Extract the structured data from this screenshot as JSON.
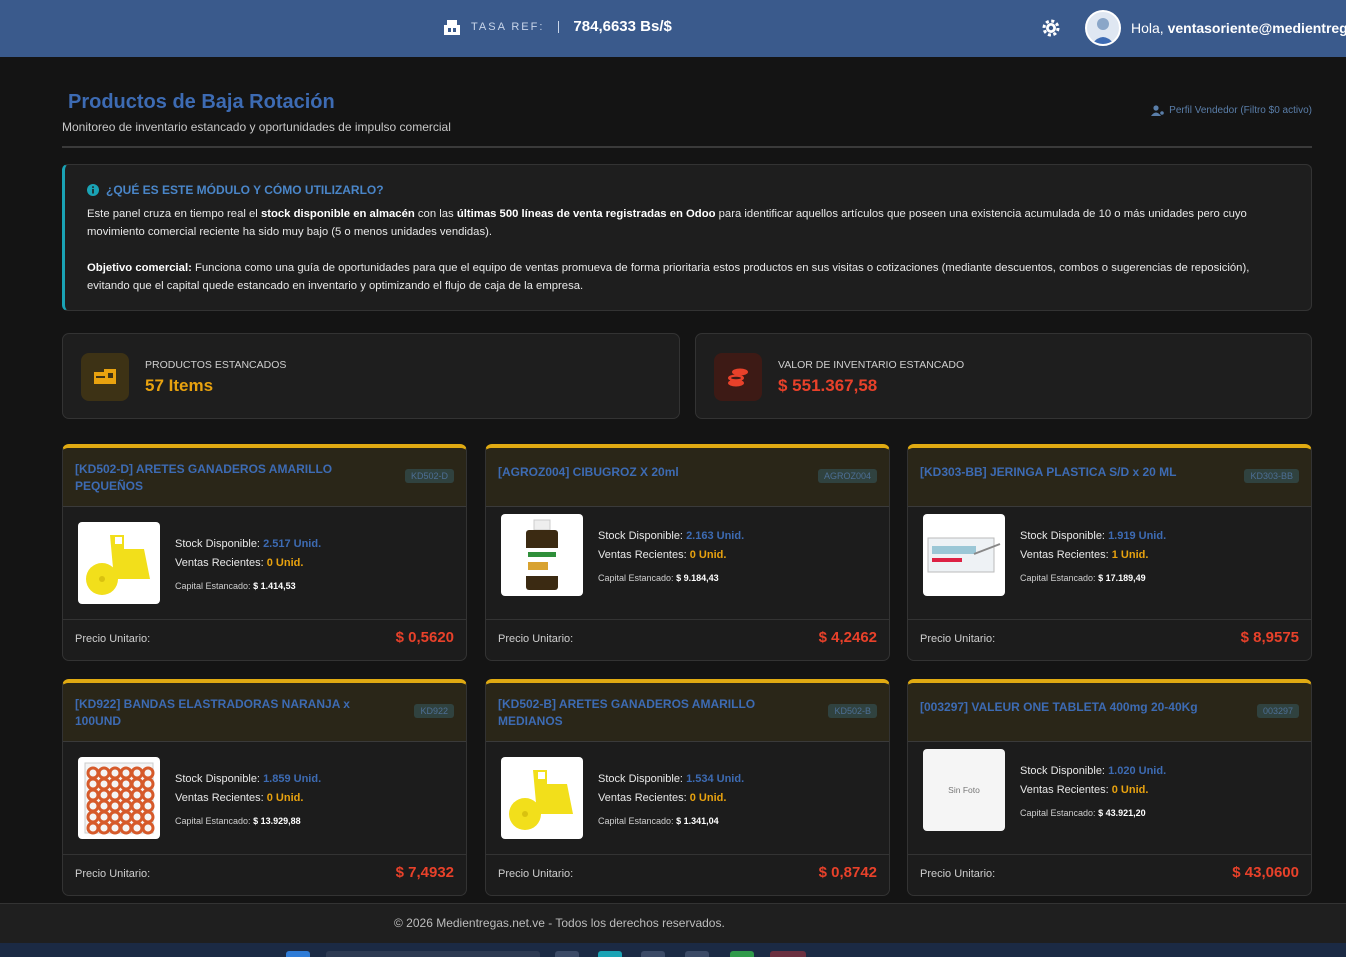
{
  "topbar": {
    "rate_label": "TASA REF:",
    "rate_value": "784,6633 Bs/$",
    "greeting_prefix": "Hola,",
    "user": "ventasoriente@medientregas.net.ve"
  },
  "page": {
    "title": "Productos de Baja Rotación",
    "subtitle": "Monitoreo de inventario estancado y oportunidades de impulso comercial",
    "profile_note": "Perfil Vendedor (Filtro $0 activo)"
  },
  "info": {
    "heading": "¿QUÉ ES ESTE MÓDULO Y CÓMO UTILIZARLO?",
    "p1_a": "Este panel cruza en tiempo real el ",
    "p1_b": "stock disponible en almacén",
    "p1_c": " con las ",
    "p1_d": "últimas 500 líneas de venta registradas en Odoo",
    "p1_e": " para identificar aquellos artículos que poseen una existencia acumulada de 10 o más unidades pero cuyo movimiento comercial reciente ha sido muy bajo (5 o menos unidades vendidas).",
    "p2_a": "Objetivo comercial:",
    "p2_b": " Funciona como una guía de oportunidades para que el equipo de ventas promueva de forma prioritaria estos productos en sus visitas o cotizaciones (mediante descuentos, combos o sugerencias de reposición), evitando que el capital quede estancado en inventario y optimizando el flujo de caja de la empresa."
  },
  "stats": {
    "products_label": "PRODUCTOS ESTANCADOS",
    "products_value": "57 Items",
    "value_label": "VALOR DE INVENTARIO ESTANCADO",
    "value_value": "$ 551.367,58"
  },
  "labels": {
    "stock": "Stock Disponible:",
    "sales": "Ventas Recientes:",
    "capital": "Capital Estancado:",
    "price": "Precio Unitario:",
    "no_photo": "Sin Foto"
  },
  "products": [
    {
      "title": "[KD502-D] ARETES GANADEROS AMARILLO PEQUEÑOS",
      "code": "KD502-D",
      "stock": "2.517 Unid.",
      "sales": "0 Unid.",
      "capital": "$ 1.414,53",
      "price": "$ 0,5620",
      "image": "yellow-ear-tag"
    },
    {
      "title": "[AGROZ004] CIBUGROZ X 20ml",
      "code": "AGROZ004",
      "stock": "2.163 Unid.",
      "sales": "0 Unid.",
      "capital": "$ 9.184,43",
      "price": "$ 4,2462",
      "image": "medicine-bottle"
    },
    {
      "title": "[KD303-BB] JERINGA PLASTICA S/D x 20 ML",
      "code": "KD303-BB",
      "stock": "1.919 Unid.",
      "sales": "1 Unid.",
      "capital": "$ 17.189,49",
      "price": "$ 8,9575",
      "image": "syringe-box"
    },
    {
      "title": "[KD922] BANDAS ELASTRADORAS NARANJA x 100UND",
      "code": "KD922",
      "stock": "1.859 Unid.",
      "sales": "0 Unid.",
      "capital": "$ 13.929,88",
      "price": "$ 7,4932",
      "image": "orange-bands"
    },
    {
      "title": "[KD502-B] ARETES GANADEROS AMARILLO MEDIANOS",
      "code": "KD502-B",
      "stock": "1.534 Unid.",
      "sales": "0 Unid.",
      "capital": "$ 1.341,04",
      "price": "$ 0,8742",
      "image": "yellow-ear-tag"
    },
    {
      "title": "[003297] VALEUR ONE TABLETA 400mg 20-40Kg",
      "code": "003297",
      "stock": "1.020 Unid.",
      "sales": "0 Unid.",
      "capital": "$ 43.921,20",
      "price": "$ 43,0600",
      "image": "none"
    }
  ],
  "footer": "© 2026 Medientregas.net.ve - Todos los derechos reservados.",
  "colors": {
    "topbar": "#3a5a8c",
    "accent_blue": "#3d6bb3",
    "accent_orange": "#e8a20f",
    "price_red": "#e8412a",
    "card_border": "#e0aa12"
  }
}
